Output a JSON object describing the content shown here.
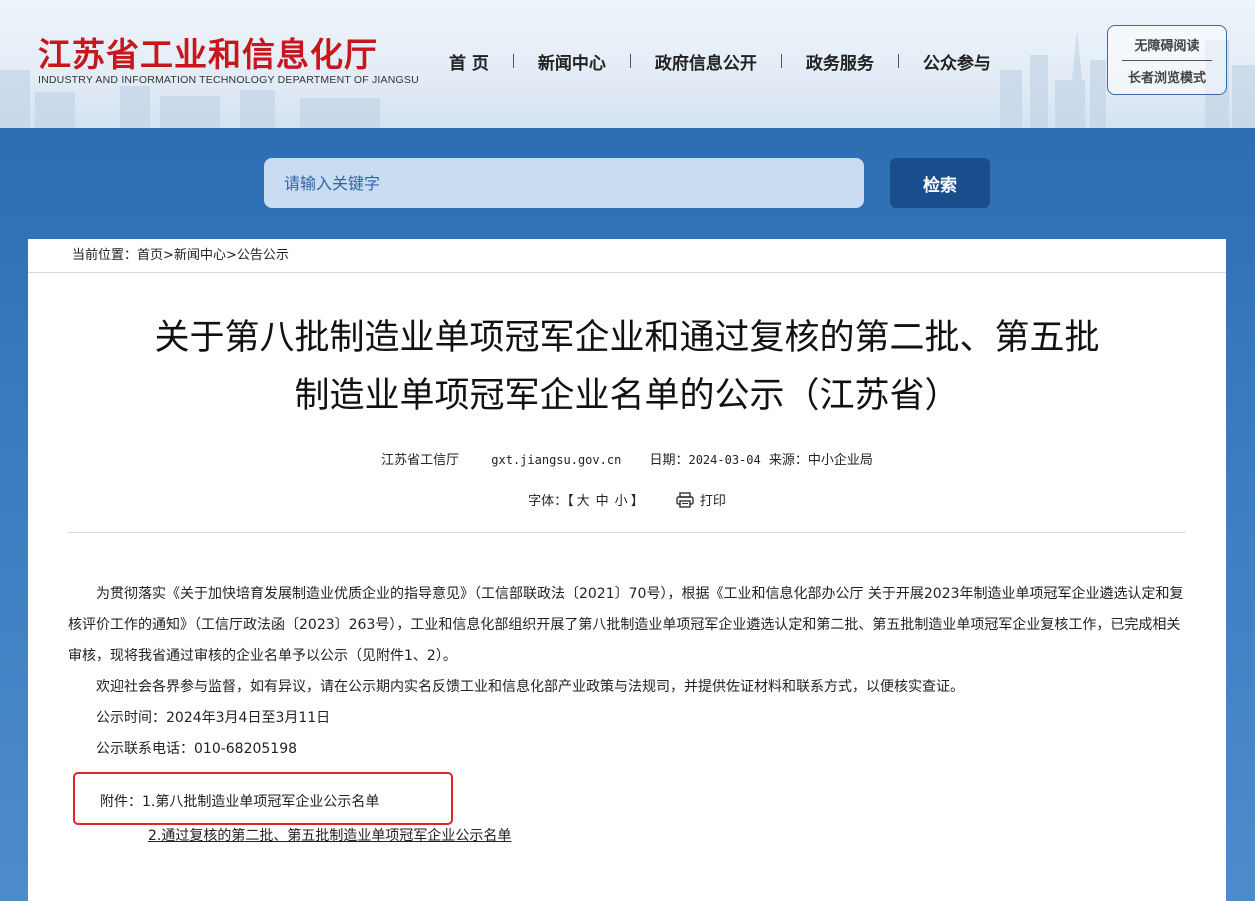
{
  "header": {
    "logo_cn": "江苏省工业和信息化厅",
    "logo_en": "INDUSTRY AND INFORMATION TECHNOLOGY DEPARTMENT OF JIANGSU",
    "nav": [
      "首 页",
      "新闻中心",
      "政府信息公开",
      "政务服务",
      "公众参与"
    ],
    "accessibility": {
      "read": "无障碍阅读",
      "elder": "长者浏览模式"
    }
  },
  "search": {
    "placeholder": "请输入关键字",
    "button": "检索"
  },
  "breadcrumb": {
    "prefix": "当前位置：",
    "items": [
      "首页",
      "新闻中心",
      "公告公示"
    ],
    "sep": ">"
  },
  "article": {
    "title_line1": "关于第八批制造业单项冠军企业和通过复核的第二批、第五批",
    "title_line2": "制造业单项冠军企业名单的公示（江苏省）",
    "publisher": "江苏省工信厅",
    "site": "gxt.jiangsu.gov.cn",
    "date_label": "日期：",
    "date": "2024-03-04",
    "source_label": "来源：",
    "source": "中小企业局",
    "font_label": "字体：【",
    "font_sizes": [
      "大",
      "中",
      "小"
    ],
    "font_end": "】",
    "print": "打印",
    "paragraphs": [
      "为贯彻落实《关于加快培育发展制造业优质企业的指导意见》（工信部联政法〔2021〕70号），根据《工业和信息化部办公厅  关于开展2023年制造业单项冠军企业遴选认定和复核评价工作的通知》（工信厅政法函〔2023〕263号），工业和信息化部组织开展了第八批制造业单项冠军企业遴选认定和第二批、第五批制造业单项冠军企业复核工作，已完成相关审核，现将我省通过审核的企业名单予以公示（见附件1、2）。",
      "欢迎社会各界参与监督，如有异议，请在公示期内实名反馈工业和信息化部产业政策与法规司，并提供佐证材料和联系方式，以便核实查证。",
      "公示时间：2024年3月4日至3月11日",
      "公示联系电话：010-68205198"
    ],
    "attachment_label": "附件：",
    "attachments": [
      "1.第八批制造业单项冠军企业公示名单",
      "2.通过复核的第二批、第五批制造业单项冠军企业公示名单"
    ]
  },
  "colors": {
    "brand_red": "#c8161d",
    "band_blue": "#2d6db2",
    "button_blue": "#194d8c",
    "highlight_red": "#e32424"
  }
}
